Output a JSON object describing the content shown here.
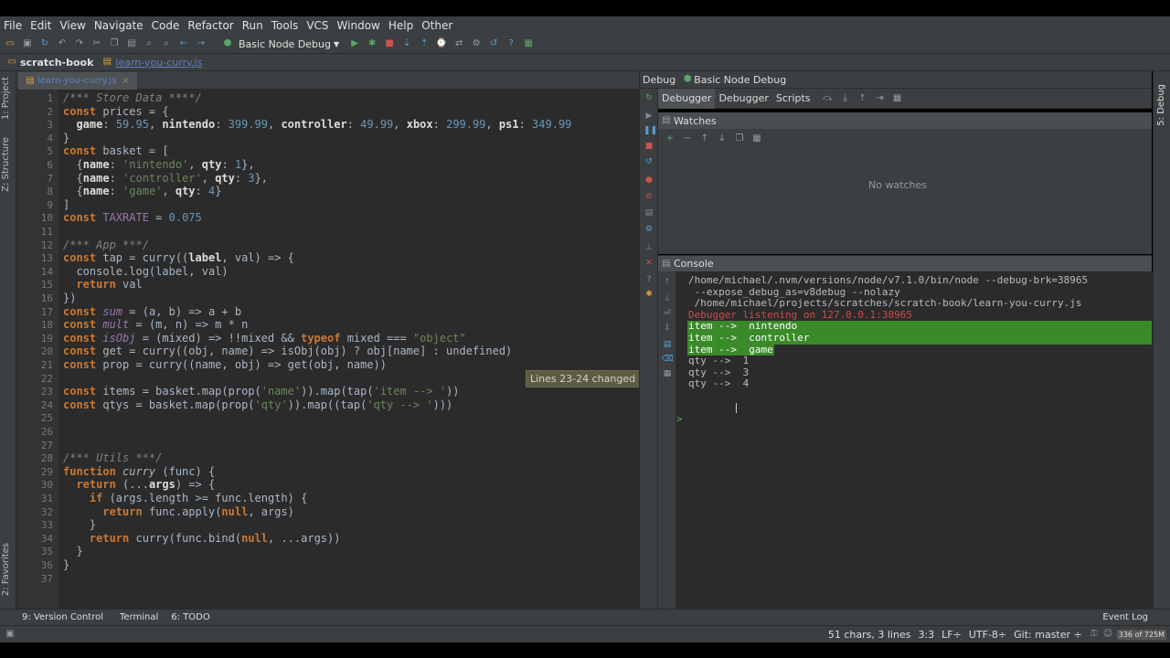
{
  "menu": [
    "File",
    "Edit",
    "View",
    "Navigate",
    "Code",
    "Refactor",
    "Run",
    "Tools",
    "VCS",
    "Window",
    "Help",
    "Other"
  ],
  "toolbar": {
    "run_config": "Basic Node Debug"
  },
  "navbar": {
    "project": "scratch-book",
    "file": "learn-you-curry.js"
  },
  "editor": {
    "tab_label": "learn-you-curry.js",
    "tooltip": "Lines 23-24 changed",
    "line_numbers": [
      "1",
      "2",
      "3",
      "4",
      "5",
      "6",
      "7",
      "8",
      "9",
      "10",
      "11",
      "12",
      "13",
      "14",
      "15",
      "16",
      "17",
      "18",
      "19",
      "20",
      "21",
      "22",
      "23",
      "24",
      "25",
      "26",
      "27",
      "28",
      "29",
      "30",
      "31",
      "32",
      "33",
      "34",
      "35",
      "36",
      "37"
    ]
  },
  "left_panel": {
    "project": "1: Project",
    "structure": "Z: Structure",
    "favorites": "2: Favorites"
  },
  "right_panel": {
    "debug": "5: Debug"
  },
  "debug": {
    "title": "Debug",
    "config": "Basic Node Debug",
    "tabs": [
      "Debugger",
      "Debugger",
      "Scripts"
    ],
    "watches_title": "Watches",
    "no_watches": "No watches",
    "console_title": "Console",
    "console_lines": [
      "/home/michael/.nvm/versions/node/v7.1.0/bin/node --debug-brk=38965",
      " --expose_debug_as=v8debug --nolazy",
      " /home/michael/projects/scratches/scratch-book/learn-you-curry.js"
    ],
    "console_error": "Debugger listening on 127.0.0.1:38965",
    "console_highlight": [
      "item -->  nintendo",
      "item -->  controller",
      "item -->  game"
    ],
    "console_output": [
      "qty -->  1",
      "qty -->  3",
      "qty -->  4"
    ],
    "prompt": ">"
  },
  "bottom_tabs": [
    "9: Version Control",
    "Terminal",
    "6: TODO",
    "Event Log"
  ],
  "status": {
    "selection": "51 chars, 3 lines",
    "position": "3:3",
    "line_sep": "LF÷",
    "encoding": "UTF-8÷",
    "git": "Git: master ÷",
    "memory": "336 of 725M"
  },
  "colors": {
    "keyword": "#cc7832",
    "string": "#6a8759",
    "number": "#6897bb",
    "comment": "#808080",
    "highlight": "#3a8a2a"
  }
}
